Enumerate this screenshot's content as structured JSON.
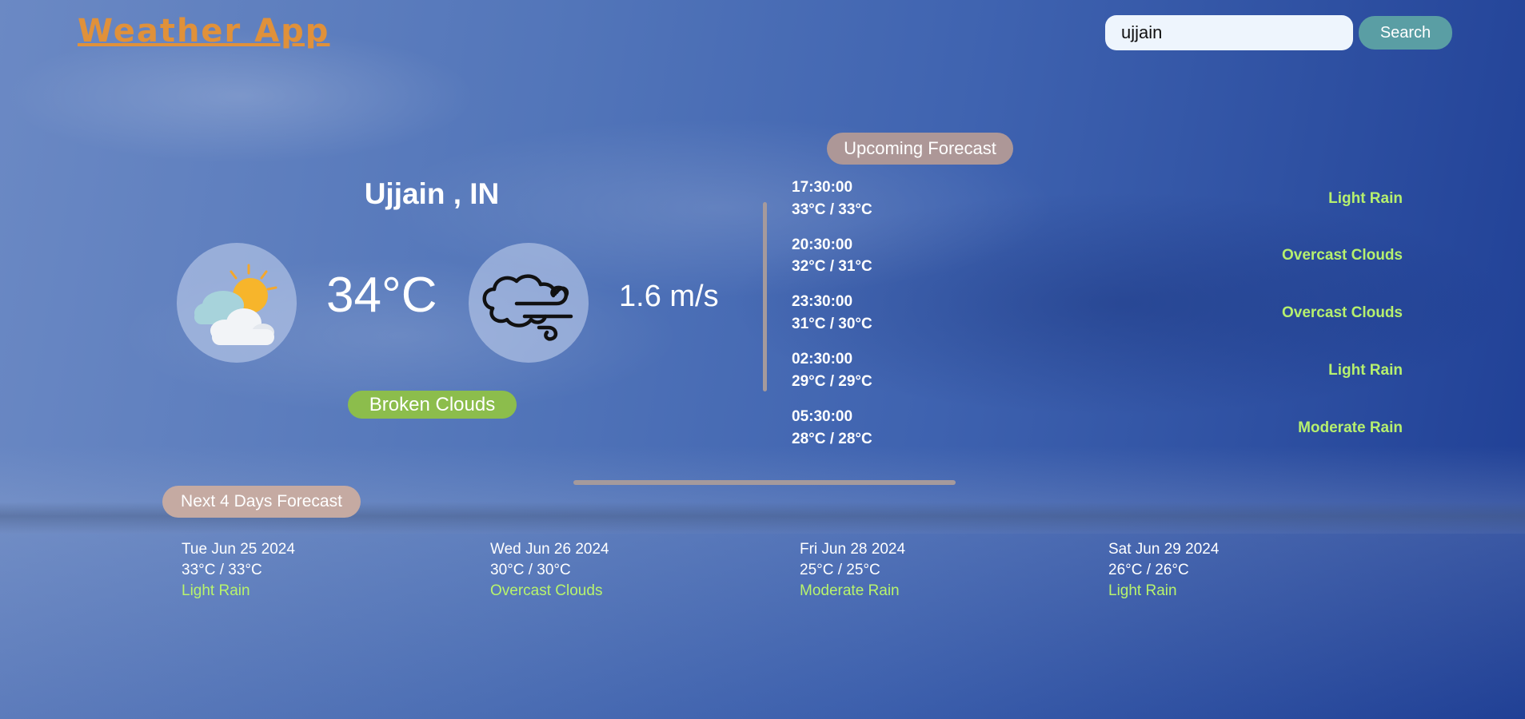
{
  "app": {
    "title": "Weather App"
  },
  "search": {
    "value": "ujjain",
    "button_label": "Search"
  },
  "current": {
    "city": "Ujjain , IN",
    "temperature": "34°C",
    "wind": "1.6 m/s",
    "description": "Broken Clouds",
    "weather_icon": "sun-cloud-icon",
    "wind_icon": "wind-cloud-icon"
  },
  "upcoming": {
    "title": "Upcoming Forecast",
    "items": [
      {
        "time": "17:30:00",
        "temp": "33°C / 33°C",
        "desc": "Light Rain"
      },
      {
        "time": "20:30:00",
        "temp": "32°C / 31°C",
        "desc": "Overcast Clouds"
      },
      {
        "time": "23:30:00",
        "temp": "31°C / 30°C",
        "desc": "Overcast Clouds"
      },
      {
        "time": "02:30:00",
        "temp": "29°C / 29°C",
        "desc": "Light Rain"
      },
      {
        "time": "05:30:00",
        "temp": "28°C / 28°C",
        "desc": "Moderate Rain"
      }
    ]
  },
  "days": {
    "title": "Next 4 Days Forecast",
    "items": [
      {
        "date": "Tue Jun 25 2024",
        "temp": "33°C / 33°C",
        "desc": "Light Rain"
      },
      {
        "date": "Wed Jun 26 2024",
        "temp": "30°C / 30°C",
        "desc": "Overcast Clouds"
      },
      {
        "date": "Fri Jun 28 2024",
        "temp": "25°C / 25°C",
        "desc": "Moderate Rain"
      },
      {
        "date": "Sat Jun 29 2024",
        "temp": "26°C / 26°C",
        "desc": "Light Rain"
      }
    ]
  },
  "colors": {
    "logo": "#e0913a",
    "search_button": "#5a9ea4",
    "description_badge": "#8cbd4c",
    "forecast_text": "#b6f06e",
    "badge": "#ad9797"
  }
}
